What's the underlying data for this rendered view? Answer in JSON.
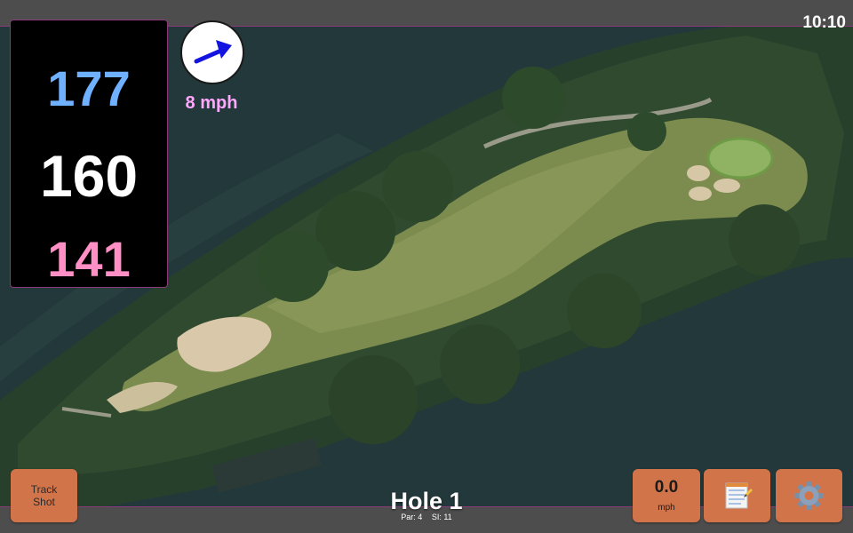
{
  "status_bar": {
    "time": "10:10"
  },
  "distances": {
    "back": "177",
    "middle": "160",
    "front": "141",
    "colors": {
      "back": "#6fb0ff",
      "middle": "#ffffff",
      "front": "#ff8fc4"
    }
  },
  "wind": {
    "speed_label": "8 mph",
    "color": "#ffa6ff",
    "arrow_color": "#1414e0",
    "arrow_icon": "wind-direction-arrow-icon"
  },
  "hole": {
    "title": "Hole 1",
    "par_label": "Par: 4",
    "si_label": "SI: 11"
  },
  "buttons": {
    "track_shot": "Track Shot",
    "speed_value": "0.0",
    "speed_unit": "mph",
    "notes_icon": "notepad-icon",
    "settings_icon": "gear-icon",
    "color": "#d2744a"
  }
}
